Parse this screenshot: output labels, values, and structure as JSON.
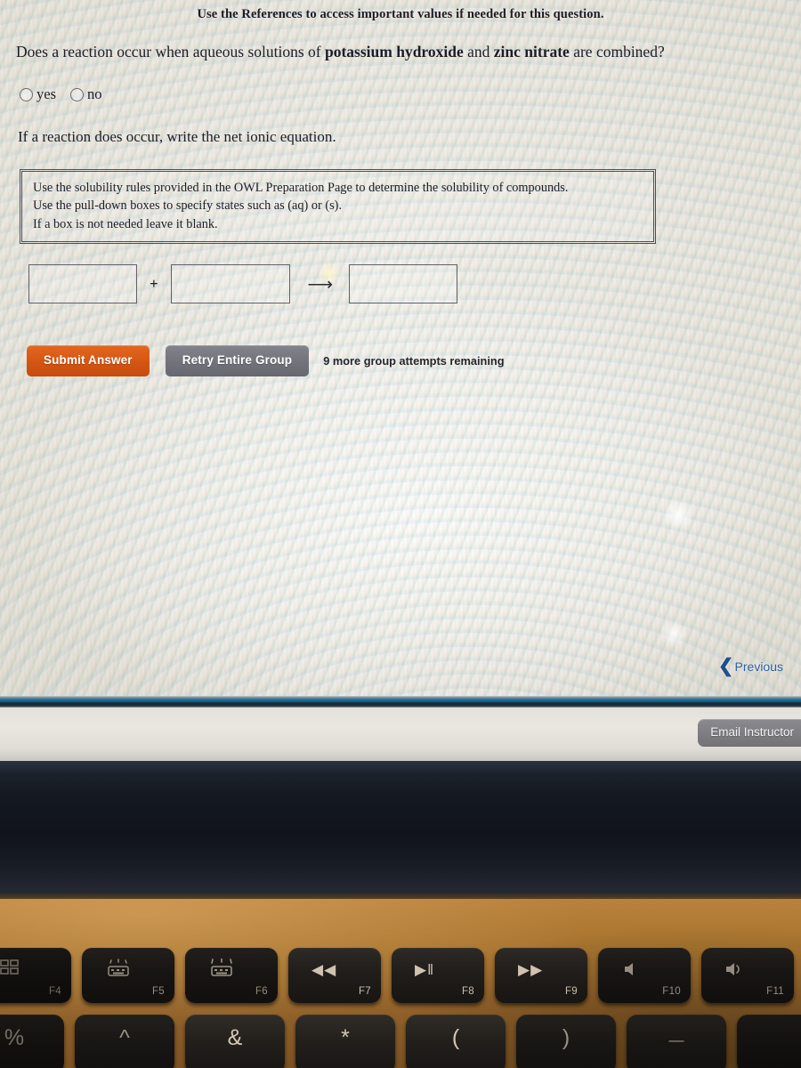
{
  "screen": {
    "header_note": "Use the References to access important values if needed for this question.",
    "question": {
      "prefix": "Does a reaction occur when aqueous solutions of ",
      "reagent_1": "potassium hydroxide",
      "conjunction": " and ",
      "reagent_2": "zinc nitrate",
      "suffix": " are combined?"
    },
    "radio_options": [
      {
        "label": "yes",
        "selected": false
      },
      {
        "label": "no",
        "selected": false
      }
    ],
    "sub_question": "If a reaction does occur, write the net ionic equation.",
    "instructions": [
      "Use the solubility rules provided in the OWL Preparation Page to determine the solubility of compounds.",
      "Use the pull-down boxes to specify states such as (aq) or (s).",
      "If a box is not needed leave it blank."
    ],
    "equation_row": {
      "box_1_value": "",
      "box_2_value": "",
      "box_3_value": "",
      "plus_operator": "+",
      "arrow_operator": "⟶"
    },
    "buttons": {
      "submit_label": "Submit Answer",
      "retry_label": "Retry Entire Group",
      "attempts_text": "9 more group attempts remaining",
      "previous_label": "Previous",
      "previous_icon": "chevron-left-icon",
      "email_instructor_label": "Email Instructor"
    },
    "colors": {
      "submit_button": "#d35412",
      "retry_button": "#71717a",
      "previous_link": "#2a5f9e",
      "email_button": "#7d7d82",
      "page_background": "#e9e7df",
      "separator_strip": "#17628c"
    }
  },
  "keyboard": {
    "function_row": [
      {
        "fn": "F4",
        "icon": "launchpad-grid-icon"
      },
      {
        "fn": "F5",
        "icon": "keyboard-backlight-down-icon"
      },
      {
        "fn": "F6",
        "icon": "keyboard-backlight-up-icon"
      },
      {
        "fn": "F7",
        "icon": "rewind-icon",
        "glyph": "◀◀"
      },
      {
        "fn": "F8",
        "icon": "play-pause-icon",
        "glyph": "▶‖"
      },
      {
        "fn": "F9",
        "icon": "fast-forward-icon",
        "glyph": "▶▶"
      },
      {
        "fn": "F10",
        "icon": "mute-icon"
      },
      {
        "fn": "F11",
        "icon": "volume-up-icon"
      },
      {
        "fn": "",
        "icon": "volume-key-partial-icon"
      }
    ],
    "number_row": [
      {
        "glyph": "%"
      },
      {
        "glyph": "^"
      },
      {
        "glyph": "&"
      },
      {
        "glyph": "*"
      },
      {
        "glyph": "("
      },
      {
        "glyph": ")"
      },
      {
        "glyph": "—"
      },
      {
        "glyph": ""
      }
    ]
  }
}
